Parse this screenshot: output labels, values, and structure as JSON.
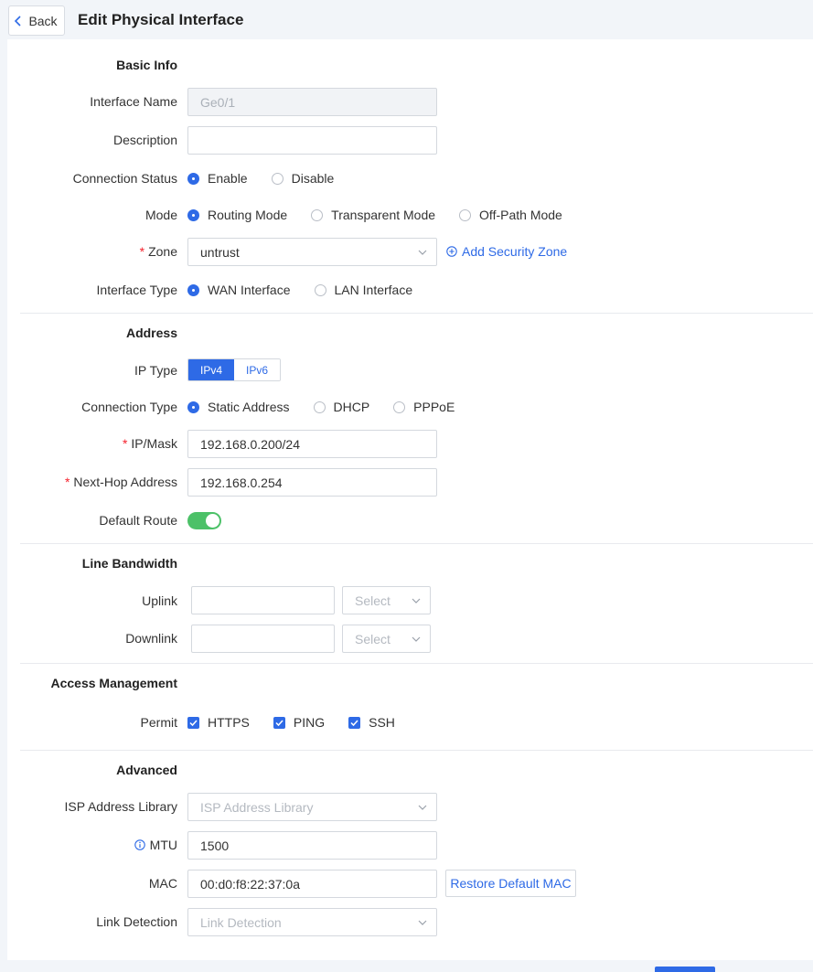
{
  "header": {
    "back_label": "Back",
    "title": "Edit Physical Interface"
  },
  "basic": {
    "title": "Basic Info",
    "interface_name_label": "Interface Name",
    "interface_name_value": "Ge0/1",
    "description_label": "Description",
    "description_value": "",
    "connection_status_label": "Connection Status",
    "connection_status_options": [
      "Enable",
      "Disable"
    ],
    "connection_status_selected": "Enable",
    "mode_label": "Mode",
    "mode_options": [
      "Routing Mode",
      "Transparent Mode",
      "Off-Path Mode"
    ],
    "mode_selected": "Routing Mode",
    "zone_label": "Zone",
    "zone_value": "untrust",
    "add_zone_label": "Add Security Zone",
    "interface_type_label": "Interface Type",
    "interface_type_options": [
      "WAN Interface",
      "LAN Interface"
    ],
    "interface_type_selected": "WAN Interface"
  },
  "address": {
    "title": "Address",
    "ip_type_label": "IP Type",
    "ip_type_options": [
      "IPv4",
      "IPv6"
    ],
    "ip_type_selected": "IPv4",
    "connection_type_label": "Connection Type",
    "connection_type_options": [
      "Static Address",
      "DHCP",
      "PPPoE"
    ],
    "connection_type_selected": "Static Address",
    "ip_mask_label": "IP/Mask",
    "ip_mask_value": "192.168.0.200/24",
    "next_hop_label": "Next-Hop Address",
    "next_hop_value": "192.168.0.254",
    "default_route_label": "Default Route",
    "default_route_on": true
  },
  "bandwidth": {
    "title": "Line Bandwidth",
    "uplink_label": "Uplink",
    "uplink_value": "",
    "uplink_unit_placeholder": "Select",
    "downlink_label": "Downlink",
    "downlink_value": "",
    "downlink_unit_placeholder": "Select"
  },
  "access": {
    "title": "Access Management",
    "permit_label": "Permit",
    "permit_options": [
      "HTTPS",
      "PING",
      "SSH"
    ]
  },
  "advanced": {
    "title": "Advanced",
    "isp_label": "ISP Address Library",
    "isp_placeholder": "ISP Address Library",
    "mtu_label": "MTU",
    "mtu_value": "1500",
    "mac_label": "MAC",
    "mac_value": "00:d0:f8:22:37:0a",
    "restore_mac_label": "Restore Default MAC",
    "link_detection_label": "Link Detection",
    "link_detection_placeholder": "Link Detection"
  },
  "colors": {
    "primary": "#2e6ae6",
    "toggle_on": "#4cc168",
    "required": "#f5222d"
  }
}
